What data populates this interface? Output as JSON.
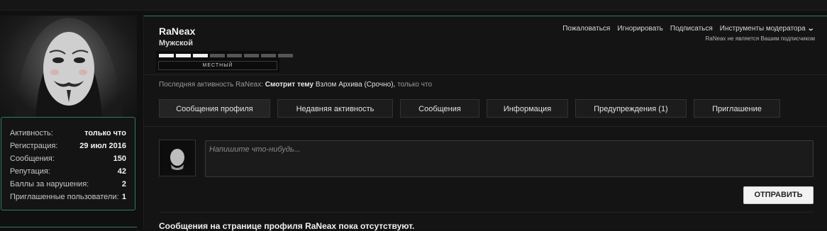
{
  "profile": {
    "username": "RaNeax",
    "gender": "Мужской",
    "rank": {
      "title": "МЕСТНЫЙ",
      "level_filled": 3,
      "level_total": 8
    }
  },
  "stats": [
    {
      "label": "Активность:",
      "value": "только что"
    },
    {
      "label": "Регистрация:",
      "value": "29 июл 2016"
    },
    {
      "label": "Сообщения:",
      "value": "150"
    },
    {
      "label": "Репутация:",
      "value": "42"
    },
    {
      "label": "Баллы за нарушения:",
      "value": "2"
    },
    {
      "label": "Приглашенные пользователи:",
      "value": "1"
    }
  ],
  "actions": {
    "report": "Пожаловаться",
    "ignore": "Игнорировать",
    "follow": "Подписаться",
    "moderator_tools": "Инструменты модератора",
    "follow_status": "RaNeax не является Вашим подписчиком"
  },
  "last_activity": {
    "prefix": "Последняя активность RaNeax:",
    "action": "Смотрит тему",
    "thread": "Взлом Архива (Срочно),",
    "time": "только что"
  },
  "tabs": [
    {
      "label": "Сообщения профиля",
      "active": true
    },
    {
      "label": "Недавняя активность",
      "active": false
    },
    {
      "label": "Сообщения",
      "active": false
    },
    {
      "label": "Информация",
      "active": false
    },
    {
      "label": "Предупреждения (1)",
      "active": false
    },
    {
      "label": "Приглашение",
      "active": false
    }
  ],
  "composer": {
    "placeholder": "Напишите что-нибудь...",
    "submit_label": "ОТПРАВИТЬ"
  },
  "empty_message": "Сообщения на странице профиля RaNeax пока отсутствуют.",
  "colors": {
    "accent": "#2e7d5b",
    "background": "#101010",
    "panel": "#141414"
  }
}
